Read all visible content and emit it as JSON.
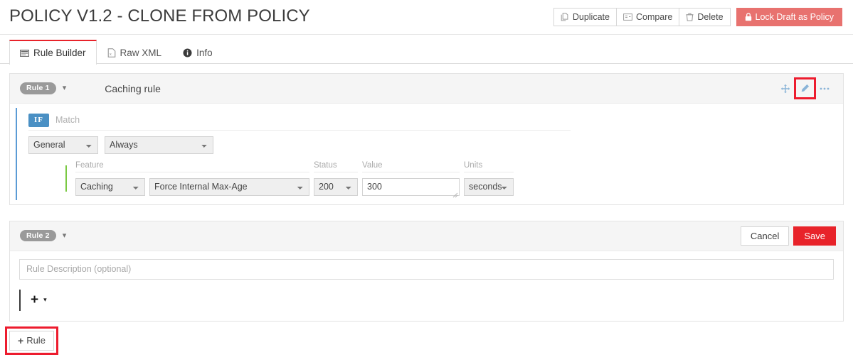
{
  "header": {
    "title": "POLICY V1.2 - CLONE FROM POLICY",
    "actions": [
      {
        "label": "Duplicate",
        "icon": "copy-icon"
      },
      {
        "label": "Compare",
        "icon": "compare-icon"
      },
      {
        "label": "Delete",
        "icon": "trash-icon"
      }
    ],
    "lock_button": {
      "label": "Lock Draft as Policy",
      "icon": "lock-icon",
      "color": "#e8726f"
    }
  },
  "tabs": [
    {
      "label": "Rule Builder",
      "icon": "window-icon",
      "active": true
    },
    {
      "label": "Raw XML",
      "icon": "xml-file-icon",
      "active": false
    },
    {
      "label": "Info",
      "icon": "info-circle-icon",
      "active": false
    }
  ],
  "rules": [
    {
      "badge": "Rule 1",
      "title": "Caching rule",
      "head_icons": [
        {
          "name": "move-icon",
          "highlighted": false
        },
        {
          "name": "edit-pencil-icon",
          "highlighted": true
        },
        {
          "name": "more-ellipsis-icon",
          "highlighted": false
        }
      ],
      "condition": {
        "if_badge": "IF",
        "match_label": "Match",
        "category": "General",
        "operator": "Always"
      },
      "action": {
        "labels": {
          "feature": "Feature",
          "status": "Status",
          "value": "Value",
          "units": "Units"
        },
        "feature": "Caching",
        "feature_option": "Force Internal Max-Age",
        "status": "200",
        "value": "300",
        "units": "seconds"
      }
    },
    {
      "badge": "Rule 2",
      "title": "",
      "cancel_label": "Cancel",
      "save_label": "Save",
      "description_placeholder": "Rule Description (optional)",
      "add_label": "+"
    }
  ],
  "footer": {
    "add_rule_label": "Rule",
    "add_rule_plus": "+"
  },
  "colors": {
    "accent_red": "#e8232a",
    "lock_red": "#e8726f",
    "annotation_red": "#ed1c2e",
    "if_blue": "#4a90c4",
    "condition_accent": "#5b9bd5",
    "action_accent": "#7ac943"
  }
}
